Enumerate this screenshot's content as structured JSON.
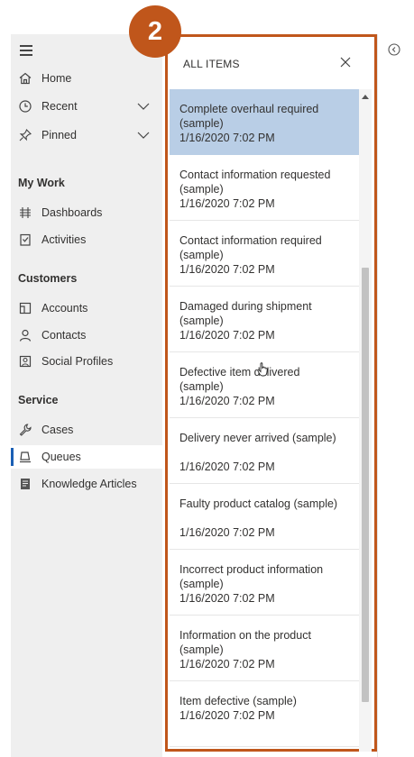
{
  "sitemap": {
    "items": [
      {
        "label": "Home",
        "icon": "home-icon"
      },
      {
        "label": "Recent",
        "icon": "clock-icon",
        "expandable": true
      },
      {
        "label": "Pinned",
        "icon": "pin-icon",
        "expandable": true
      }
    ],
    "groups": [
      {
        "header": "My Work",
        "items": [
          {
            "label": "Dashboards",
            "icon": "dashboard-icon"
          },
          {
            "label": "Activities",
            "icon": "activities-icon"
          }
        ]
      },
      {
        "header": "Customers",
        "items": [
          {
            "label": "Accounts",
            "icon": "accounts-icon"
          },
          {
            "label": "Contacts",
            "icon": "contact-icon"
          },
          {
            "label": "Social Profiles",
            "icon": "social-profile-icon"
          }
        ]
      },
      {
        "header": "Service",
        "items": [
          {
            "label": "Cases",
            "icon": "wrench-icon"
          },
          {
            "label": "Queues",
            "icon": "queue-icon",
            "selected": true
          },
          {
            "label": "Knowledge Articles",
            "icon": "book-icon"
          }
        ]
      }
    ]
  },
  "panel": {
    "title": "ALL ITEMS",
    "items": [
      {
        "title": "Complete overhaul required (sample)",
        "date": "1/16/2020 7:02 PM",
        "selected": true
      },
      {
        "title": "Contact information requested (sample)",
        "date": "1/16/2020 7:02 PM"
      },
      {
        "title": "Contact information required (sample)",
        "date": "1/16/2020 7:02 PM"
      },
      {
        "title": "Damaged during shipment (sample)",
        "date": "1/16/2020 7:02 PM"
      },
      {
        "title": "Defective item delivered (sample)",
        "date": "1/16/2020 7:02 PM"
      },
      {
        "title": "Delivery never arrived (sample)",
        "date": "1/16/2020 7:02 PM"
      },
      {
        "title": "Faulty product catalog (sample)",
        "date": "1/16/2020 7:02 PM"
      },
      {
        "title": "Incorrect product information (sample)",
        "date": "1/16/2020 7:02 PM"
      },
      {
        "title": "Information on the product (sample)",
        "date": "1/16/2020 7:02 PM"
      },
      {
        "title": "Item defective (sample)",
        "date": "1/16/2020 7:02 PM"
      }
    ]
  },
  "badge": {
    "label": "2"
  },
  "colors": {
    "accent": "#c0561b",
    "selected": "#b9cee6",
    "nav_bg": "#efefef",
    "selection_bar": "#1a5fb4"
  }
}
